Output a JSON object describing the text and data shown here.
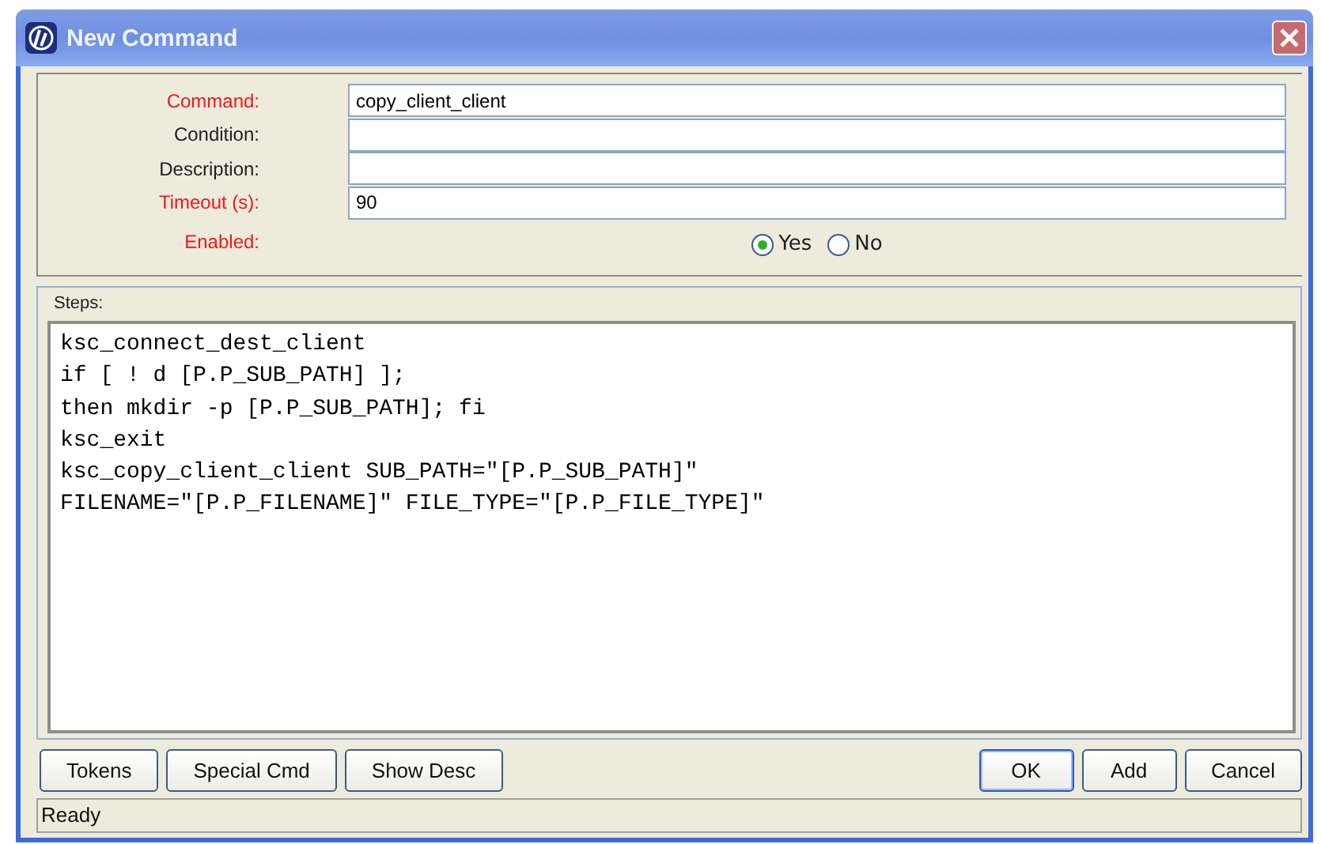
{
  "window": {
    "title": "New Command"
  },
  "fields": [
    {
      "label": "Command:",
      "required": true,
      "value": "copy_client_client"
    },
    {
      "label": "Condition:",
      "required": false
    },
    {
      "label": "Description:",
      "required": false
    },
    {
      "label": "Timeout (s):",
      "required": true,
      "value": "90"
    }
  ],
  "enabled": {
    "label": "Enabled:",
    "required": true,
    "options": [
      {
        "label": "Yes",
        "selected": true
      },
      {
        "label": "No",
        "selected": false
      }
    ]
  },
  "steps": {
    "label": "Steps:",
    "lines": [
      "ksc_connect_dest_client",
      "if [ ! d [P.P_SUB_PATH] ];",
      "then mkdir -p [P.P_SUB_PATH]; fi",
      "ksc_exit",
      "ksc_copy_client_client SUB_PATH=\"[P.P_SUB_PATH]\"",
      "FILENAME=\"[P.P_FILENAME]\" FILE_TYPE=\"[P.P_FILE_TYPE]\""
    ]
  },
  "left_buttons": [
    {
      "label": "Tokens",
      "default": false
    },
    {
      "label": "Special Cmd",
      "default": false
    },
    {
      "label": "Show Desc",
      "default": false
    }
  ],
  "right_buttons": [
    {
      "label": "OK",
      "default": true
    },
    {
      "label": "Add",
      "default": false
    },
    {
      "label": "Cancel",
      "default": false
    }
  ],
  "status_bar": "Ready"
}
